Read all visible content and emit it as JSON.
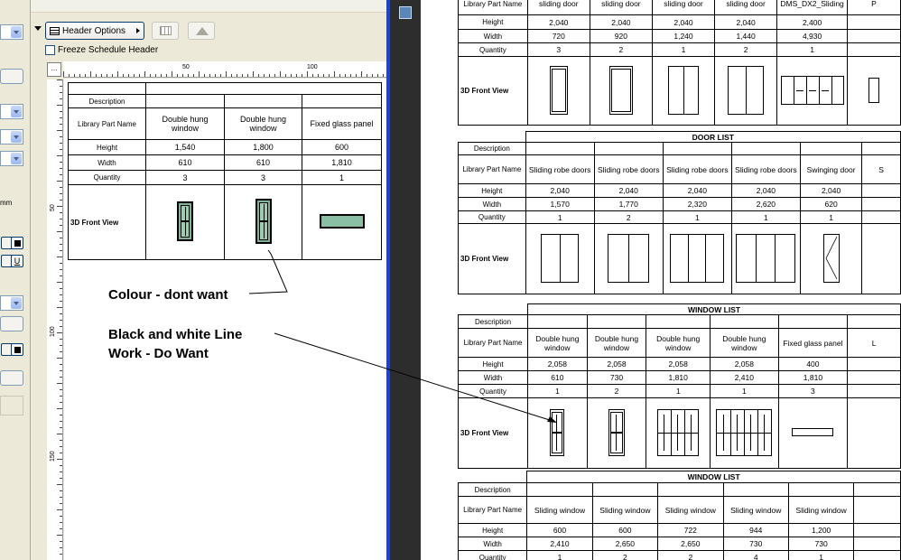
{
  "left_window": {
    "header_options_label": "Header Options",
    "freeze_label": "Freeze Schedule Header",
    "palette_text_mm": "mm",
    "palette_text_u": "U",
    "ruler_corner": "...",
    "hruler_labels": [
      "50",
      "100"
    ],
    "vruler_labels": [
      "50",
      "100",
      "150"
    ],
    "schedule": {
      "rows": {
        "description": "Description",
        "library": "Library Part Name",
        "height": "Height",
        "width": "Width",
        "quantity": "Quantity",
        "view": "3D Front View"
      },
      "columns": [
        {
          "name": "Double hung window",
          "height": "1,540",
          "width": "610",
          "quantity": "3",
          "glyph": "dh-color"
        },
        {
          "name": "Double hung window",
          "height": "1,800",
          "width": "610",
          "quantity": "3",
          "glyph": "dh-color"
        },
        {
          "name": "Fixed glass panel",
          "height": "600",
          "width": "1,810",
          "quantity": "1",
          "glyph": "fixed-color"
        }
      ]
    }
  },
  "annotations": {
    "colour": "Colour - dont want",
    "bw_line1": "Black and white Line",
    "bw_line2": "Work - Do Want"
  },
  "right_document": {
    "labels": {
      "description": "Description",
      "library": "Library Part Name",
      "height": "Height",
      "width": "Width",
      "quantity": "Quantity",
      "view": "3D Front View"
    },
    "table1": {
      "columns": [
        {
          "name": "sliding door",
          "height": "2,040",
          "width": "720",
          "quantity": "3"
        },
        {
          "name": "sliding door",
          "height": "2,040",
          "width": "920",
          "quantity": "2"
        },
        {
          "name": "sliding door",
          "height": "2,040",
          "width": "1,240",
          "quantity": "1"
        },
        {
          "name": "sliding door",
          "height": "2,040",
          "width": "1,440",
          "quantity": "2"
        },
        {
          "name": "DMS_DX2_Sliding",
          "height": "2,400",
          "width": "4,930",
          "quantity": "1"
        },
        {
          "name": "P",
          "height": "",
          "width": "",
          "quantity": ""
        }
      ]
    },
    "table2": {
      "title": "DOOR LIST",
      "columns": [
        {
          "name": "Sliding robe doors",
          "height": "2,040",
          "width": "1,570",
          "quantity": "1"
        },
        {
          "name": "Sliding robe doors",
          "height": "2,040",
          "width": "1,770",
          "quantity": "2"
        },
        {
          "name": "Sliding robe doors",
          "height": "2,040",
          "width": "2,320",
          "quantity": "1"
        },
        {
          "name": "Sliding robe doors",
          "height": "2,040",
          "width": "2,620",
          "quantity": "1"
        },
        {
          "name": "Swinging door",
          "height": "2,040",
          "width": "620",
          "quantity": "1"
        },
        {
          "name": "S",
          "height": "",
          "width": "",
          "quantity": ""
        }
      ]
    },
    "table3": {
      "title": "WINDOW LIST",
      "columns": [
        {
          "name": "Double hung window",
          "height": "2,058",
          "width": "610",
          "quantity": "1"
        },
        {
          "name": "Double hung window",
          "height": "2,058",
          "width": "730",
          "quantity": "2"
        },
        {
          "name": "Double hung window",
          "height": "2,058",
          "width": "1,810",
          "quantity": "1"
        },
        {
          "name": "Double hung window",
          "height": "2,058",
          "width": "2,410",
          "quantity": "1"
        },
        {
          "name": "Fixed glass panel",
          "height": "400",
          "width": "1,810",
          "quantity": "3"
        },
        {
          "name": "L",
          "height": "",
          "width": "",
          "quantity": ""
        }
      ]
    },
    "table4": {
      "title": "WINDOW LIST",
      "columns": [
        {
          "name": "Sliding window",
          "height": "600",
          "width": "2,410",
          "quantity": "1"
        },
        {
          "name": "Sliding window",
          "height": "600",
          "width": "2,650",
          "quantity": "2"
        },
        {
          "name": "Sliding window",
          "height": "722",
          "width": "2,650",
          "quantity": "2"
        },
        {
          "name": "Sliding window",
          "height": "944",
          "width": "730",
          "quantity": "4"
        },
        {
          "name": "Sliding window",
          "height": "1,200",
          "width": "730",
          "quantity": "1"
        },
        {
          "name": "",
          "height": "",
          "width": "",
          "quantity": ""
        }
      ]
    }
  }
}
